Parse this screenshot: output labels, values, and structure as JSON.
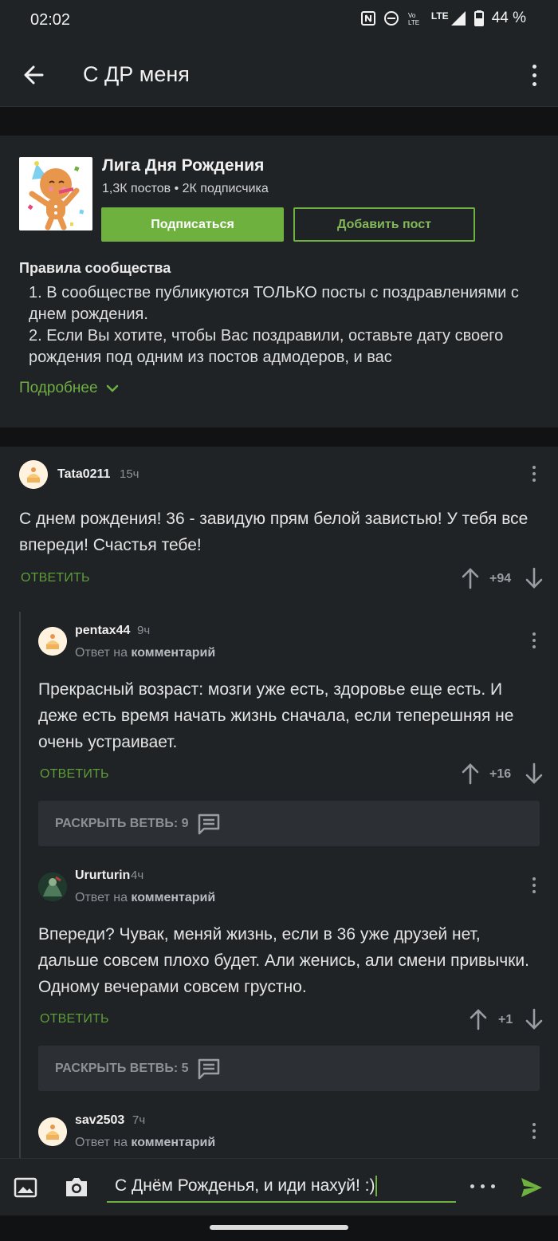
{
  "status_bar": {
    "time": "02:02",
    "lte_label": "LTE",
    "battery": "44 %",
    "icons": [
      "nfc-icon",
      "dnd-icon",
      "volte-icon",
      "signal-icon",
      "battery-icon"
    ]
  },
  "app_bar": {
    "title": "С ДР меня",
    "icons": [
      "back-arrow-icon",
      "more-vert-icon"
    ]
  },
  "community": {
    "name": "Лига Дня Рождения",
    "stats": "1,3К постов • 2К подписчика",
    "subscribe_label": "Подписаться",
    "add_post_label": "Добавить пост",
    "rules_title": "Правила сообщества",
    "rules": [
      "1. В сообществе публикуются ТОЛЬКО посты с поздравлениями с днем рождения.",
      "2. Если Вы хотите, чтобы Вас поздравили, оставьте дату своего рождения под одним из постов адмодеров, и вас"
    ],
    "more_label": "Подробнее"
  },
  "comments": [
    {
      "user": "Tata0211",
      "time": "15ч",
      "reply_prefix": "",
      "reply_target": "",
      "text": "С днем рождения! 36 - завидую прям белой завистью! У тебя все впереди! Счастья тебе!",
      "answer_label": "ОТВЕТИТЬ",
      "score": "+94"
    },
    {
      "user": "pentax44",
      "time": "9ч",
      "reply_prefix": "Ответ на",
      "reply_target": "комментарий",
      "text": "Прекрасный возраст: мозги уже есть, здоровье еще есть. И деже есть время начать жизнь сначала, если теперешняя не очень устраивает.",
      "answer_label": "ОТВЕТИТЬ",
      "score": "+16",
      "expand_label": "РАСКРЫТЬ ВЕТВЬ: 9"
    },
    {
      "user": "Ururturin",
      "time": "4ч",
      "reply_prefix": "Ответ на",
      "reply_target": "комментарий",
      "text": "Впереди? Чувак, меняй жизнь, если в 36 уже друзей нет, дальше совсем плохо будет. Али женись, али смени привычки. Одному вечерами совсем грустно.",
      "answer_label": "ОТВЕТИТЬ",
      "score": "+1",
      "expand_label": "РАСКРЫТЬ ВЕТВЬ: 5"
    },
    {
      "user": "sav2503",
      "time": "7ч",
      "reply_prefix": "Ответ на",
      "reply_target": "комментарий"
    }
  ],
  "composer": {
    "value": "С Днём Рожденья, и иди нахуй! :)",
    "icons": [
      "image-icon",
      "camera-icon",
      "more-horiz-icon",
      "send-icon"
    ]
  },
  "colors": {
    "background": "#202326",
    "accent": "#6fb13f",
    "link": "#5e9b39",
    "muted": "#8d9196"
  }
}
